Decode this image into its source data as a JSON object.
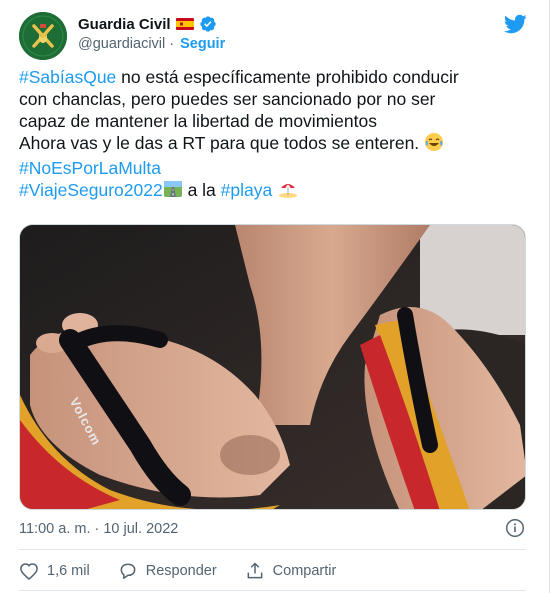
{
  "account": {
    "display_name": "Guardia Civil",
    "handle": "@guardiacivil",
    "separator": "·",
    "follow_label": "Seguir",
    "flag": "spain-flag-emoji",
    "verified": "verified-badge-icon"
  },
  "tweet": {
    "line1_hashtag": "#SabíasQue",
    "line1_rest": " no está específicamente prohibido conducir",
    "line2": "con chanclas, pero puedes ser sancionado por no ser",
    "line3": "capaz de mantener la libertad de movimientos",
    "line4": "Ahora vas y le das a RT para que todos se enteren. ",
    "line4_emoji": "tears-of-joy-emoji",
    "line5_hashtag": "#NoEsPorLaMulta",
    "line6_hashtag1": "#ViajeSeguro2022",
    "line6_emoji1": "motorway-emoji",
    "line6_mid": " a la ",
    "line6_hashtag2": "#playa",
    "line6_emoji2": "beach-umbrella-emoji"
  },
  "media": {
    "description_icon": "feet-in-flip-flops-photo",
    "sandal_brand": "Volcom"
  },
  "meta": {
    "timestamp": "11:00 a. m. · 10 jul. 2022"
  },
  "actions": {
    "likes_count": "1,6 mil",
    "reply_label": "Responder",
    "share_label": "Compartir"
  },
  "colors": {
    "link": "#1d9bf0",
    "text": "#0f1419",
    "secondary": "#536471",
    "border": "#e1e8ed"
  }
}
